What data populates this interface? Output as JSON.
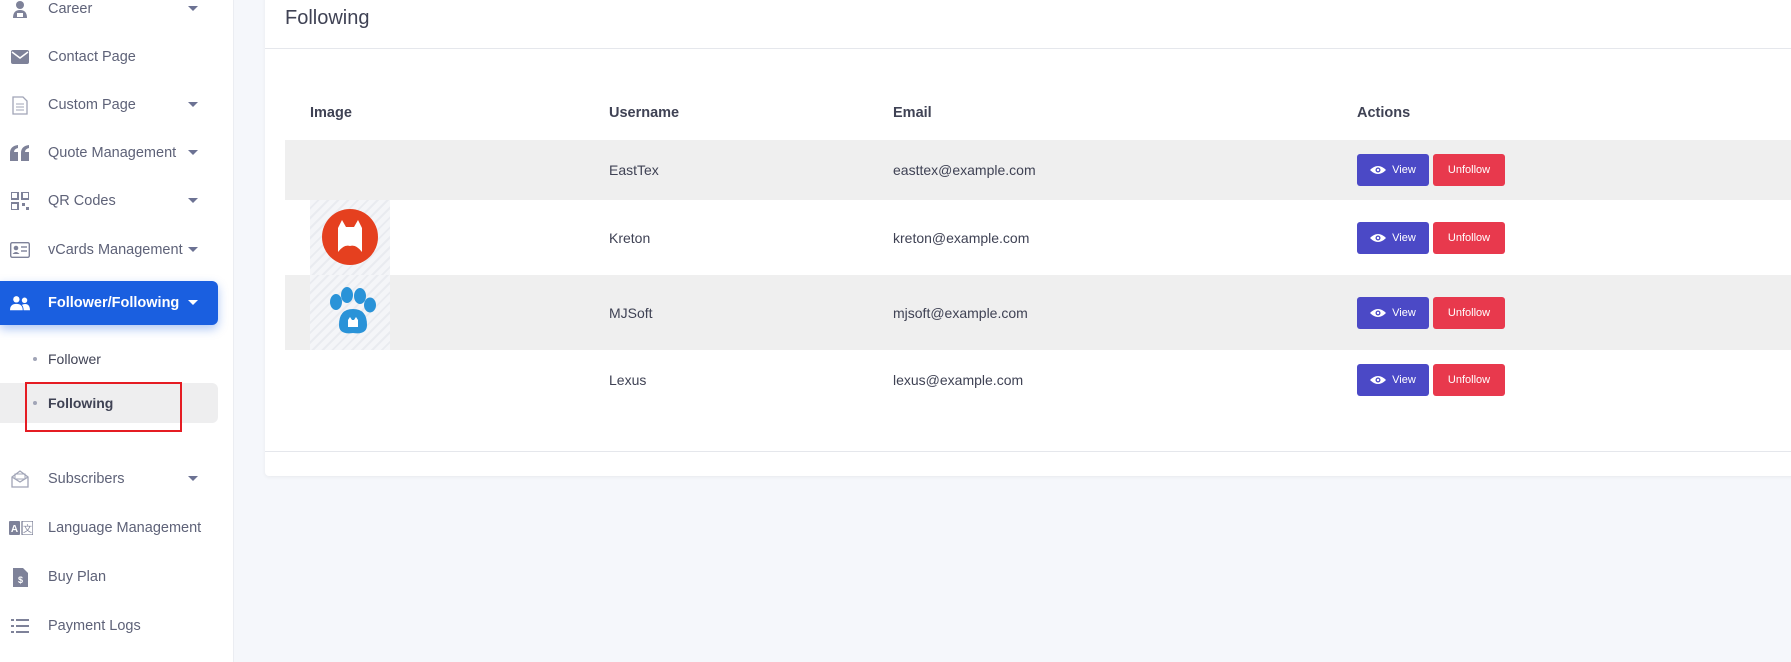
{
  "sidebar": {
    "items": [
      {
        "label": "Career",
        "icon": "user-tie-icon",
        "has_submenu": true
      },
      {
        "label": "Contact Page",
        "icon": "envelope-icon",
        "has_submenu": false
      },
      {
        "label": "Custom Page",
        "icon": "file-text-icon",
        "has_submenu": true
      },
      {
        "label": "Quote Management",
        "icon": "quote-icon",
        "has_submenu": true
      },
      {
        "label": "QR Codes",
        "icon": "qr-code-icon",
        "has_submenu": true
      },
      {
        "label": "vCards Management",
        "icon": "id-card-icon",
        "has_submenu": true
      },
      {
        "label": "Follower/Following",
        "icon": "users-icon",
        "has_submenu": true,
        "active": true
      },
      {
        "label": "Subscribers",
        "icon": "mail-open-icon",
        "has_submenu": true
      },
      {
        "label": "Language Management",
        "icon": "language-icon",
        "has_submenu": false
      },
      {
        "label": "Buy Plan",
        "icon": "invoice-dollar-icon",
        "has_submenu": false
      },
      {
        "label": "Payment Logs",
        "icon": "list-icon",
        "has_submenu": false
      }
    ],
    "submenu": [
      {
        "label": "Follower"
      },
      {
        "label": "Following",
        "active": true
      }
    ]
  },
  "page": {
    "title": "Following"
  },
  "table": {
    "headers": [
      "Image",
      "Username",
      "Email",
      "Actions"
    ],
    "rows": [
      {
        "image": "",
        "username": "EastTex",
        "email": "easttex@example.com"
      },
      {
        "image": "red-cat-logo",
        "username": "Kreton",
        "email": "kreton@example.com"
      },
      {
        "image": "blue-paw-logo",
        "username": "MJSoft",
        "email": "mjsoft@example.com"
      },
      {
        "image": "",
        "username": "Lexus",
        "email": "lexus@example.com"
      }
    ],
    "view_label": "View",
    "unfollow_label": "Unfollow"
  },
  "colors": {
    "primary": "#1a5fe0",
    "view_button": "#4b49c6",
    "unfollow_button": "#e8394d",
    "highlight": "#e51c23"
  }
}
